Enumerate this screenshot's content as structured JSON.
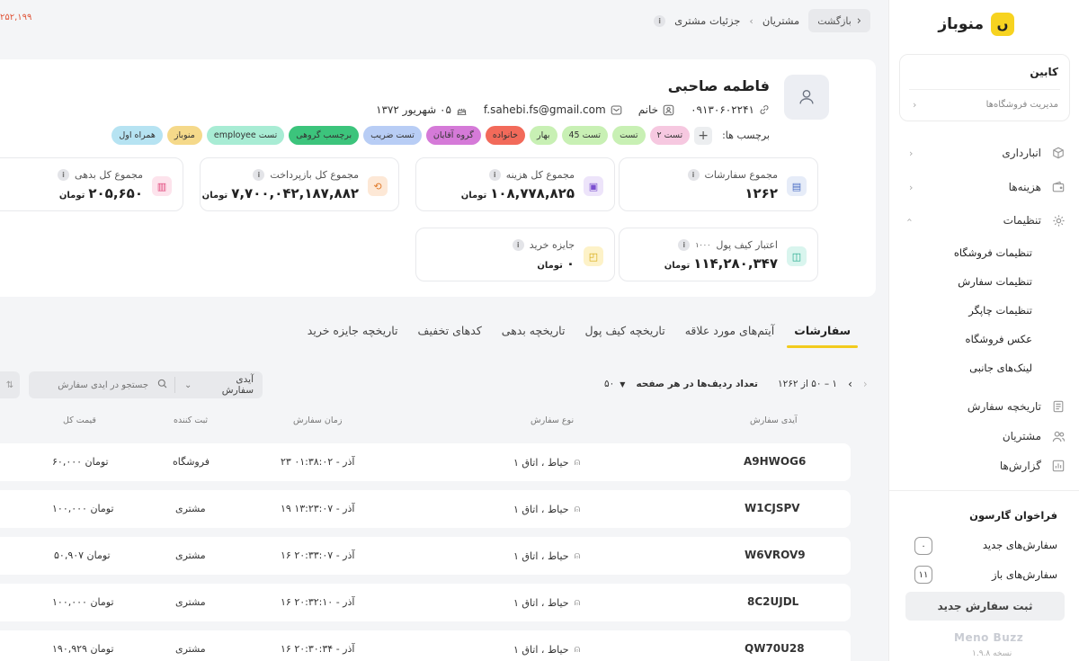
{
  "topbar": {
    "back_label": "بازگشت",
    "crumb_1": "مشتریان",
    "crumb_sep": "›",
    "crumb_2": "جزئیات مشتری",
    "left_number": "۲۵۲,۱۹۹"
  },
  "sidebar": {
    "brand": "منوباز",
    "cabin_title": "کابین",
    "cabin_sub": "مدیریت فروشگاه‌ها",
    "nav": [
      {
        "label": "انبارداری",
        "icon": "cube-icon"
      },
      {
        "label": "هزینه‌ها",
        "icon": "wallet-icon"
      },
      {
        "label": "تنظیمات",
        "icon": "gear-icon"
      }
    ],
    "settings_sub": [
      "تنظیمات فروشگاه",
      "تنظیمات سفارش",
      "تنظیمات چاپگر",
      "عکس فروشگاه",
      "لینک‌های جانبی"
    ],
    "nav2": [
      {
        "label": "تاریخچه سفارش",
        "icon": "document-icon"
      },
      {
        "label": "مشتریان",
        "icon": "users-icon"
      },
      {
        "label": "گزارش‌ها",
        "icon": "chart-icon"
      }
    ],
    "waiter_call": "فراخوان گارسون",
    "new_orders_label": "سفارش‌های جدید",
    "new_orders_count": "۰",
    "open_orders_label": "سفارش‌های باز",
    "open_orders_count": "۱۱",
    "new_order_button": "ثبت سفارش جدید",
    "footer_brand": "Meno Buzz",
    "version": "نسخه ۱.۹.۸"
  },
  "profile": {
    "name": "فاطمه صاحبی",
    "phone": "۰۹۱۳۰۶۰۲۲۴۱",
    "gender": "خانم",
    "email": "f.sahebi.fs@gmail.com",
    "birthday": "۰۵ شهریور ۱۳۷۲",
    "tags_label": "برچسب ها:",
    "tags": [
      {
        "label": "تست ۲",
        "color": "#f6c8e0"
      },
      {
        "label": "تست",
        "color": "#c8f0b4"
      },
      {
        "label": "تست 45",
        "color": "#c8f0b4"
      },
      {
        "label": "بهار",
        "color": "#c8f0b4"
      },
      {
        "label": "خانواده",
        "color": "#f26a5a"
      },
      {
        "label": "گروه آقایان",
        "color": "#d57ad8"
      },
      {
        "label": "تست ضریب",
        "color": "#b8cdf5"
      },
      {
        "label": "برچسب گروهی",
        "color": "#3cc47c"
      },
      {
        "label": "تست employee",
        "color": "#a8ecd4"
      },
      {
        "label": "منوباز",
        "color": "#f5d98a"
      },
      {
        "label": "همراه اول",
        "color": "#b6e3f2"
      }
    ]
  },
  "stats": [
    {
      "label": "مجموع سفارشات",
      "value": "۱۲۶۲",
      "unit": "",
      "icon": "document-icon",
      "bg": "#e6ecf8",
      "fg": "#4a6cc4"
    },
    {
      "label": "مجموع کل هزینه",
      "value": "۱۰۸,۷۷۸,۸۲۵",
      "unit": "تومان",
      "icon": "receipt-icon",
      "bg": "#ede4fa",
      "fg": "#7b4fd0"
    },
    {
      "label": "مجموع کل بازپرداخت",
      "value": "۷,۷۰۰,۰۴۲,۱۸۷,۸۸۲",
      "unit": "تومان",
      "icon": "refund-icon",
      "bg": "#fde8d6",
      "fg": "#e07a2a"
    },
    {
      "label": "مجموع کل بدهی",
      "value": "۲۰۵,۶۵۰",
      "unit": "تومان",
      "icon": "debt-icon",
      "bg": "#fde3ec",
      "fg": "#e0457a"
    },
    {
      "label": "اعتبار کیف پول",
      "extra": "۱۰۰۰",
      "value": "۱۱۴,۲۸۰,۳۴۷",
      "unit": "تومان",
      "icon": "wallet-icon",
      "bg": "#d9f5ee",
      "fg": "#1fa88a"
    },
    {
      "label": "جایزه خرید",
      "value": "۰",
      "unit": "تومان",
      "icon": "gift-icon",
      "bg": "#fdf2c8",
      "fg": "#d6a80e"
    }
  ],
  "tabs": [
    "سفارشات",
    "آیتم‌های مورد علاقه",
    "تاریخچه کیف پول",
    "تاریخچه بدهی",
    "کدهای تخفیف",
    "تاریخچه جایزه خرید"
  ],
  "pager": {
    "range": "۱ – ۵۰ از ۱۲۶۲",
    "per_page_label": "تعداد ردیف‌ها در هر صفحه",
    "per_page_value": "۵۰"
  },
  "search": {
    "field_select": "آیدی سفارش",
    "placeholder": "جستجو در آیدی سفارش"
  },
  "table": {
    "headers": {
      "id": "آیدی سفارش",
      "type": "نوع سفارش",
      "time": "زمان سفارش",
      "creator": "ثبت کننده",
      "total": "قیمت کل"
    },
    "rows": [
      {
        "id": "A9HWOG6",
        "type": "حیاط ، اتاق ۱",
        "time": "۲۳ آذر - ۰۱:۳۸:۰۲",
        "creator": "فروشگاه",
        "total": "۶۰,۰۰۰ تومان"
      },
      {
        "id": "W1CJSPV",
        "type": "حیاط ، اتاق ۱",
        "time": "۱۹ آذر - ۱۳:۲۳:۰۷",
        "creator": "مشتری",
        "total": "۱۰۰,۰۰۰ تومان"
      },
      {
        "id": "W6VROV9",
        "type": "حیاط ، اتاق ۱",
        "time": "۱۶ آذر - ۲۰:۳۳:۰۷",
        "creator": "مشتری",
        "total": "۵۰,۹۰۷ تومان"
      },
      {
        "id": "8C2UJDL",
        "type": "حیاط ، اتاق ۱",
        "time": "۱۶ آذر - ۲۰:۳۲:۱۰",
        "creator": "مشتری",
        "total": "۱۰۰,۰۰۰ تومان"
      },
      {
        "id": "QW70U28",
        "type": "حیاط ، اتاق ۱",
        "time": "۱۶ آذر - ۲۰:۳۰:۳۴",
        "creator": "مشتری",
        "total": "۱۹۰,۹۲۹ تومان"
      }
    ]
  }
}
